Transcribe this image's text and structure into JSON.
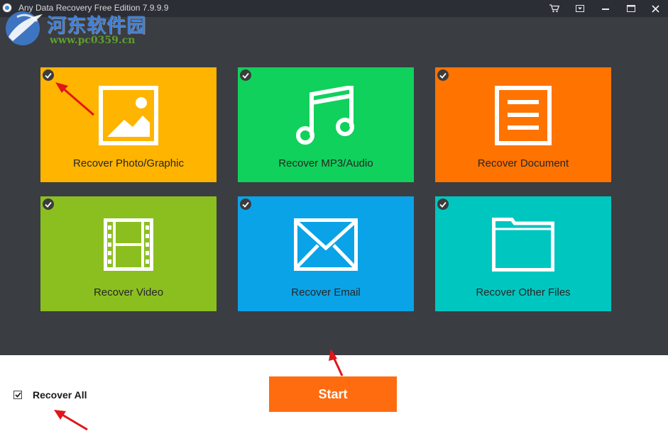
{
  "window": {
    "title": "Any Data Recovery Free Edition 7.9.9.9",
    "buttons": [
      "cart-icon",
      "dropdown-icon",
      "minimize-icon",
      "maximize-icon",
      "close-icon"
    ]
  },
  "watermark": {
    "chinese": "河东软件园",
    "url": "www.pc0359.cn"
  },
  "tiles": [
    {
      "label": "Recover Photo/Graphic",
      "color": "#ffb400",
      "icon": "image-icon",
      "checked": true
    },
    {
      "label": "Recover MP3/Audio",
      "color": "#10d15c",
      "icon": "music-note-icon",
      "checked": true
    },
    {
      "label": "Recover Document",
      "color": "#ff7300",
      "icon": "document-icon",
      "checked": true
    },
    {
      "label": "Recover Video",
      "color": "#8bbf1f",
      "icon": "film-icon",
      "checked": true
    },
    {
      "label": "Recover Email",
      "color": "#0aa3e8",
      "icon": "envelope-icon",
      "checked": true
    },
    {
      "label": "Recover Other Files",
      "color": "#00c6c0",
      "icon": "folder-icon",
      "checked": true
    }
  ],
  "bottom": {
    "recover_all_label": "Recover All",
    "recover_all_checked": true,
    "start_label": "Start"
  },
  "colors": {
    "background": "#3a3d42",
    "titlebar": "#2b2e35",
    "start_button": "#ff6c10",
    "annotation_arrow": "#e0161b"
  }
}
